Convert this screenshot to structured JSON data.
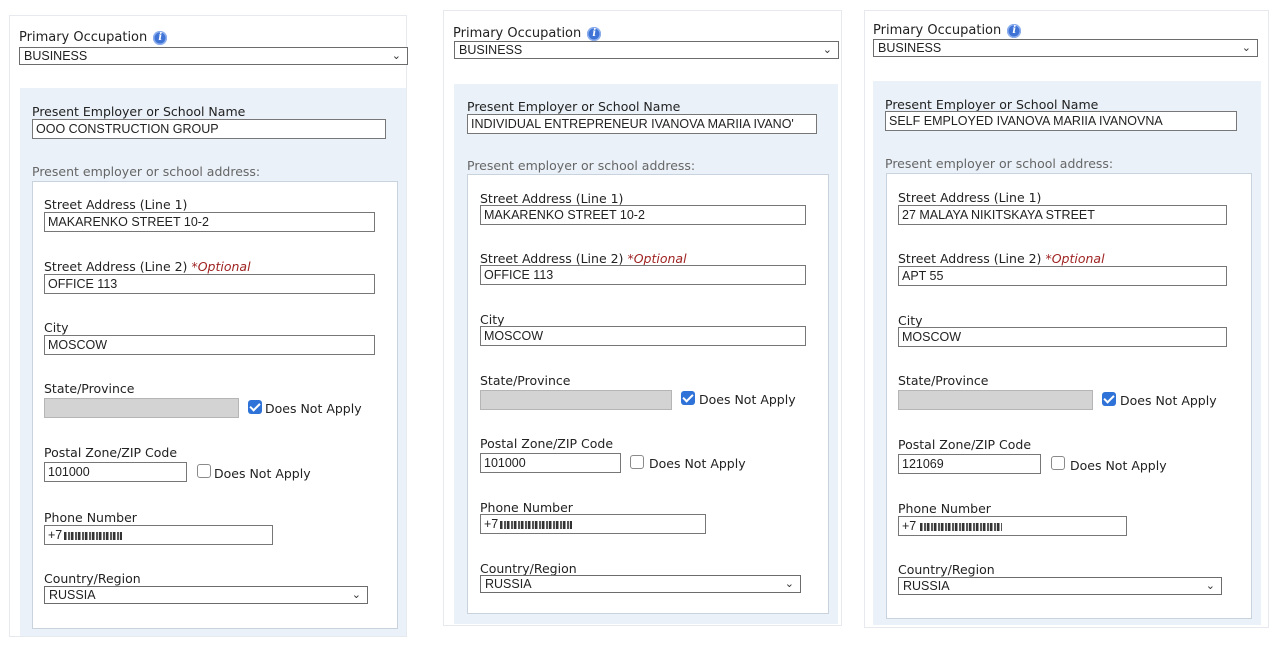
{
  "panels": [
    {
      "occupation_label": "Primary Occupation",
      "occupation_value": "BUSINESS",
      "employer_label": "Present Employer or School Name",
      "employer_value": "OOO CONSTRUCTION GROUP",
      "address_heading": "Present employer or school address:",
      "street1_label": "Street Address (Line 1)",
      "street1_value": "MAKARENKO STREET 10-2",
      "street2_label": "Street Address (Line 2)",
      "street2_optional": "*Optional",
      "street2_value": "OFFICE 113",
      "city_label": "City",
      "city_value": "MOSCOW",
      "state_label": "State/Province",
      "state_dna_label": "Does Not Apply",
      "state_dna_checked": true,
      "postal_label": "Postal Zone/ZIP Code",
      "postal_value": "101000",
      "postal_dna_label": "Does Not Apply",
      "postal_dna_checked": false,
      "phone_label": "Phone Number",
      "phone_prefix": "+7",
      "country_label": "Country/Region",
      "country_value": "RUSSIA"
    },
    {
      "occupation_label": "Primary Occupation",
      "occupation_value": "BUSINESS",
      "employer_label": "Present Employer or School Name",
      "employer_value": "INDIVIDUAL ENTREPRENEUR IVANOVA MARIIA IVANO'",
      "address_heading": "Present employer or school address:",
      "street1_label": "Street Address (Line 1)",
      "street1_value": "MAKARENKO STREET 10-2",
      "street2_label": "Street Address (Line 2)",
      "street2_optional": "*Optional",
      "street2_value": "OFFICE 113",
      "city_label": "City",
      "city_value": "MOSCOW",
      "state_label": "State/Province",
      "state_dna_label": "Does Not Apply",
      "state_dna_checked": true,
      "postal_label": "Postal Zone/ZIP Code",
      "postal_value": "101000",
      "postal_dna_label": "Does Not Apply",
      "postal_dna_checked": false,
      "phone_label": "Phone Number",
      "phone_prefix": "+7",
      "country_label": "Country/Region",
      "country_value": "RUSSIA"
    },
    {
      "occupation_label": "Primary Occupation",
      "occupation_value": "BUSINESS",
      "employer_label": "Present Employer or School Name",
      "employer_value": "SELF EMPLOYED IVANOVA MARIIA IVANOVNA",
      "address_heading": "Present employer or school address:",
      "street1_label": "Street Address (Line 1)",
      "street1_value": "27 MALAYA NIKITSKAYA STREET",
      "street2_label": "Street Address (Line 2)",
      "street2_optional": "*Optional",
      "street2_value": "APT 55",
      "city_label": "City",
      "city_value": "MOSCOW",
      "state_label": "State/Province",
      "state_dna_label": "Does Not Apply",
      "state_dna_checked": true,
      "postal_label": "Postal Zone/ZIP Code",
      "postal_value": "121069",
      "postal_dna_label": "Does Not Apply",
      "postal_dna_checked": false,
      "phone_label": "Phone Number",
      "phone_prefix": "+7",
      "country_label": "Country/Region",
      "country_value": "RUSSIA"
    }
  ],
  "icons": {
    "info": "info-icon",
    "dropdown": "chevron-down-icon",
    "checkbox": "checkbox-icon"
  },
  "colors": {
    "accent": "#2f73d8",
    "optional": "#a02424",
    "section_bg": "#eaf1f8"
  }
}
